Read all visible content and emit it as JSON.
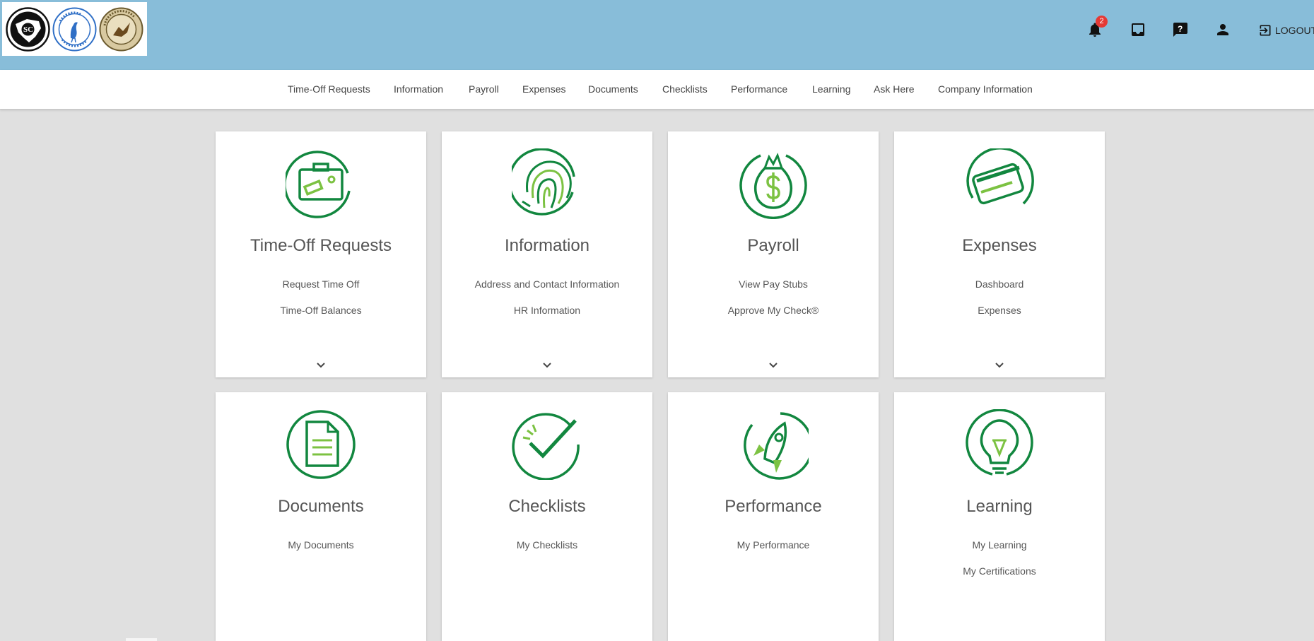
{
  "header": {
    "notifications_count": "2",
    "logout_label": "LOGOUT",
    "colors": {
      "topbar": "#88bdd9",
      "accent_green": "#12873f",
      "light_green": "#7cc242",
      "badge": "#e53935"
    }
  },
  "logos": [
    {
      "name": "south-carolina-seal",
      "text": "SC"
    },
    {
      "name": "cyber-academy-seal",
      "text": "CYBER ACADEMY OF South Carolina"
    },
    {
      "name": "virtual-academy-seal",
      "text": "VIRTUAL ACADEMY"
    }
  ],
  "nav": {
    "items": [
      "Time-Off Requests",
      "Information",
      "Payroll",
      "Expenses",
      "Documents",
      "Checklists",
      "Performance",
      "Learning",
      "Ask Here",
      "Company Information"
    ]
  },
  "cards": [
    {
      "title": "Time-Off Requests",
      "icon": "timeoff-ticket-icon",
      "links": [
        "Request Time Off",
        "Time-Off Balances"
      ],
      "expandable": true
    },
    {
      "title": "Information",
      "icon": "fingerprint-icon",
      "links": [
        "Address and Contact Information",
        "HR Information"
      ],
      "expandable": true
    },
    {
      "title": "Payroll",
      "icon": "money-bag-icon",
      "links": [
        "View Pay Stubs",
        "Approve My Check®"
      ],
      "expandable": true
    },
    {
      "title": "Expenses",
      "icon": "credit-card-icon",
      "links": [
        "Dashboard",
        "Expenses"
      ],
      "expandable": true
    },
    {
      "title": "Documents",
      "icon": "document-icon",
      "links": [
        "My Documents"
      ],
      "expandable": false
    },
    {
      "title": "Checklists",
      "icon": "checkmark-icon",
      "links": [
        "My Checklists"
      ],
      "expandable": false
    },
    {
      "title": "Performance",
      "icon": "rocket-icon",
      "links": [
        "My Performance"
      ],
      "expandable": false
    },
    {
      "title": "Learning",
      "icon": "lightbulb-icon",
      "links": [
        "My Learning",
        "My Certifications"
      ],
      "expandable": false
    }
  ]
}
